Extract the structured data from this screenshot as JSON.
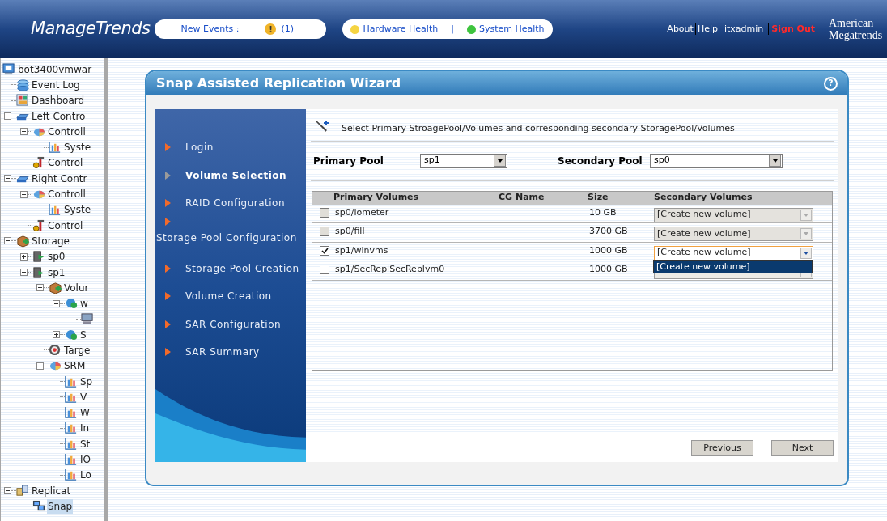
{
  "header": {
    "logo": "ManageTrends",
    "events": {
      "label": "New Events :",
      "icon": "!",
      "count": "(1)"
    },
    "health": [
      {
        "label": "Hardware Health",
        "color": "#f5d442"
      },
      {
        "label": "System Health",
        "color": "#3ec43e"
      }
    ],
    "health_separator": "|",
    "links": [
      {
        "label": "About",
        "kind": "link"
      },
      {
        "label": "Help",
        "kind": "link"
      },
      {
        "label": "itxadmin",
        "kind": "user"
      },
      {
        "label": "Sign Out",
        "kind": "signout"
      }
    ],
    "brand": [
      "American",
      "Megatrends"
    ]
  },
  "tree": {
    "label": "bot3400vmwar",
    "kind": "server",
    "children": [
      {
        "label": "Event Log",
        "kind": "log"
      },
      {
        "label": "Dashboard",
        "kind": "dash"
      },
      {
        "label": "Left Contro",
        "kind": "ctrl",
        "expanded": true,
        "children": [
          {
            "label": "Controll",
            "kind": "pie",
            "expanded": true,
            "children": [
              {
                "label": "Syste",
                "kind": "chart"
              }
            ]
          },
          {
            "label": "Control",
            "kind": "tools"
          }
        ]
      },
      {
        "label": "Right Contr",
        "kind": "ctrl",
        "expanded": true,
        "children": [
          {
            "label": "Controll",
            "kind": "pie",
            "expanded": true,
            "children": [
              {
                "label": "Syste",
                "kind": "chart"
              }
            ]
          },
          {
            "label": "Control",
            "kind": "tools"
          }
        ]
      },
      {
        "label": "Storage",
        "kind": "box",
        "expanded": true,
        "children": [
          {
            "label": "sp0",
            "kind": "pool",
            "expanded": false
          },
          {
            "label": "sp1",
            "kind": "pool",
            "expanded": true,
            "children": [
              {
                "label": "Volur",
                "kind": "box",
                "expanded": true,
                "children": [
                  {
                    "label": "w",
                    "kind": "vol",
                    "expanded": true,
                    "children": [
                      {
                        "kind": "host"
                      }
                    ]
                  },
                  {
                    "label": "S",
                    "kind": "vol",
                    "expanded": false
                  }
                ]
              },
              {
                "label": "Targe",
                "kind": "target"
              },
              {
                "label": "SRM",
                "kind": "pie",
                "expanded": true,
                "children": [
                  {
                    "label": "Sp",
                    "kind": "chart"
                  },
                  {
                    "label": "V",
                    "kind": "chart"
                  },
                  {
                    "label": "W",
                    "kind": "chart"
                  },
                  {
                    "label": "In",
                    "kind": "chart"
                  },
                  {
                    "label": "St",
                    "kind": "chart"
                  },
                  {
                    "label": "IO",
                    "kind": "chart"
                  },
                  {
                    "label": "Lo",
                    "kind": "chart"
                  }
                ]
              }
            ]
          }
        ]
      },
      {
        "label": "Replicat",
        "kind": "repl",
        "expanded": true,
        "children": [
          {
            "label": "Snap",
            "kind": "net",
            "selected": true
          }
        ]
      }
    ]
  },
  "wizard": {
    "title": "Snap Assisted Replication Wizard",
    "help_icon": "?",
    "steps": [
      {
        "label": "Login",
        "selected": false
      },
      {
        "label": "Volume Selection",
        "selected": true
      },
      {
        "label": "RAID Configuration",
        "selected": false
      },
      {
        "label": "Storage Pool Configuration",
        "selected": false,
        "kind": "wrapped"
      },
      {
        "label": "Storage Pool Creation",
        "selected": false
      },
      {
        "label": "Volume Creation",
        "selected": false
      },
      {
        "label": "SAR Configuration",
        "selected": false
      },
      {
        "label": "SAR Summary",
        "selected": false
      }
    ],
    "instruction": "Select Primary StroagePool/Volumes and corresponding secondary StoragePool/Volumes",
    "primary_pool": {
      "label": "Primary Pool",
      "value": "sp1"
    },
    "secondary_pool": {
      "label": "Secondary Pool",
      "value": "sp0"
    },
    "table": {
      "columns": [
        "Primary Volumes",
        "CG Name",
        "Size",
        "Secondary Volumes"
      ],
      "rows": [
        {
          "checked": false,
          "disabled": true,
          "volume": "sp0/iometer",
          "size": "10 GB",
          "secondary": "[Create new volume]",
          "focused": false
        },
        {
          "checked": false,
          "disabled": true,
          "volume": "sp0/fill",
          "size": "3700 GB",
          "secondary": "[Create new volume]",
          "focused": false
        },
        {
          "checked": true,
          "disabled": false,
          "volume": "sp1/winvms",
          "size": "1000 GB",
          "secondary": "[Create new volume]",
          "focused": true,
          "options": [
            "[Create new volume]"
          ]
        },
        {
          "checked": false,
          "disabled": false,
          "volume": "sp1/SecReplSecReplvm0",
          "size": "1000 GB",
          "focused": false
        }
      ]
    },
    "buttons": [
      "Previous",
      "Next"
    ]
  }
}
